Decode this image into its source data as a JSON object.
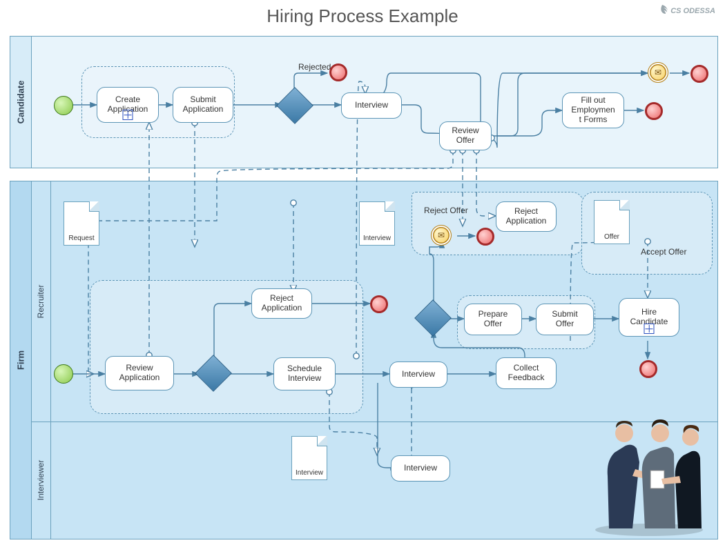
{
  "title": "Hiring Process Example",
  "logo": "CS ODESSA",
  "pools": {
    "candidate": {
      "name": "Candidate"
    },
    "firm": {
      "name": "Firm",
      "lanes": {
        "recruiter": "Recruiter",
        "interviewer": "Interviewer"
      }
    }
  },
  "tasks": {
    "create_app": "Create\nApplication",
    "submit_app": "Submit\nApplication",
    "cand_interview": "Interview",
    "review_offer": "Review\nOffer",
    "fill_forms": "Fill out\nEmploymen\nt Forms",
    "reject_app_r": "Reject\nApplication",
    "review_app": "Review\nApplication",
    "schedule_int": "Schedule\nInterview",
    "recruiter_int": "Interview",
    "collect_fb": "Collect\nFeedback",
    "prepare_offer": "Prepare\nOffer",
    "submit_offer": "Submit\nOffer",
    "hire_cand": "Hire\nCandidate",
    "reject_app_top": "Reject\nApplication",
    "interviewer_int": "Interview"
  },
  "docs": {
    "request": "Request",
    "interview1": "Interview",
    "offer": "Offer",
    "interview2": "Interview"
  },
  "labels": {
    "rejected": "Rejected",
    "reject_offer": "Reject Offer",
    "accept_offer": "Accept Offer"
  },
  "image_group": "business-people"
}
